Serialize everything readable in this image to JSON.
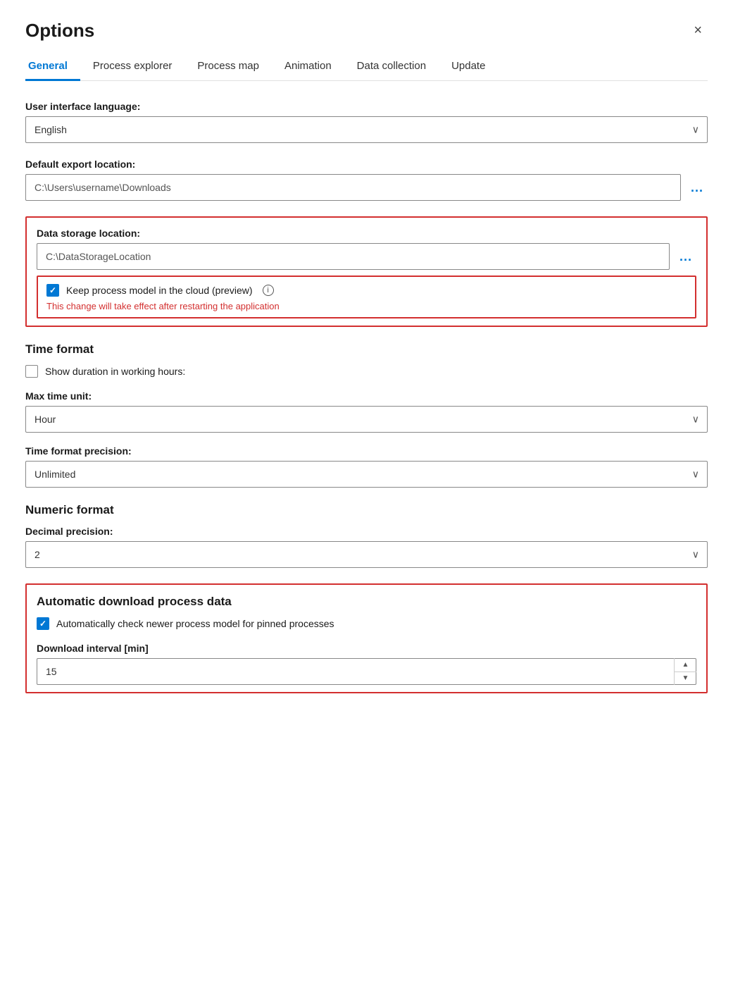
{
  "dialog": {
    "title": "Options",
    "close_label": "×"
  },
  "tabs": [
    {
      "id": "general",
      "label": "General",
      "active": true
    },
    {
      "id": "process-explorer",
      "label": "Process explorer",
      "active": false
    },
    {
      "id": "process-map",
      "label": "Process map",
      "active": false
    },
    {
      "id": "animation",
      "label": "Animation",
      "active": false
    },
    {
      "id": "data-collection",
      "label": "Data collection",
      "active": false
    },
    {
      "id": "update",
      "label": "Update",
      "active": false
    }
  ],
  "sections": {
    "ui_language": {
      "label": "User interface language:",
      "value": "English"
    },
    "export_location": {
      "label": "Default export location:",
      "value": "C:\\Users\\username\\Downloads",
      "browse_label": "..."
    },
    "data_storage": {
      "label": "Data storage location:",
      "value": "C:\\DataStorageLocation",
      "browse_label": "...",
      "checkbox_label": "Keep process model in the cloud (preview)",
      "checkbox_checked": true,
      "warning_text": "This change will take effect after restarting the application"
    },
    "time_format": {
      "title": "Time format",
      "show_duration_label": "Show duration in working hours:",
      "show_duration_checked": false,
      "max_time_unit_label": "Max time unit:",
      "max_time_unit_value": "Hour",
      "precision_label": "Time format precision:",
      "precision_value": "Unlimited"
    },
    "numeric_format": {
      "title": "Numeric format",
      "decimal_label": "Decimal precision:",
      "decimal_value": "2"
    },
    "auto_download": {
      "title": "Automatic download process data",
      "checkbox_label": "Automatically check newer process model for pinned processes",
      "checkbox_checked": true,
      "interval_label": "Download interval [min]",
      "interval_value": "15"
    }
  },
  "icons": {
    "chevron_down": "⌄",
    "chevron_up": "˄",
    "info": "i",
    "close": "✕"
  }
}
